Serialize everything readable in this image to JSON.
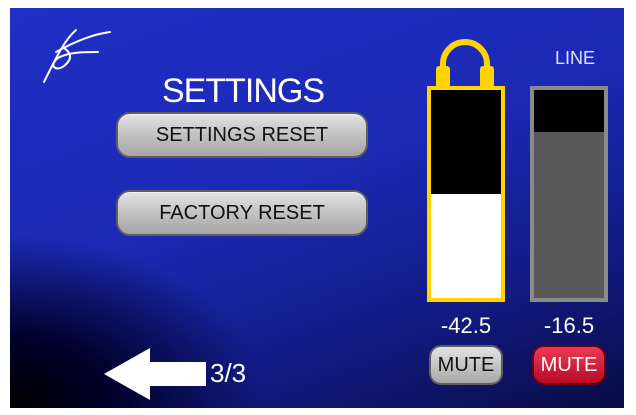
{
  "title": "SETTINGS",
  "buttons": {
    "settings_reset": "SETTINGS RESET",
    "factory_reset": "FACTORY RESET"
  },
  "channels": {
    "headphone": {
      "icon": "headphones-icon",
      "value": "-42.5",
      "level_fraction": 0.5,
      "mute_label": "MUTE",
      "muted": false,
      "color": "#ffd400"
    },
    "line": {
      "label": "LINE",
      "value": "-16.5",
      "level_fraction": 0.8,
      "mute_label": "MUTE",
      "muted": true,
      "color": "#8a8a8a"
    }
  },
  "navigation": {
    "page": "3/3",
    "back_icon": "arrow-left-icon"
  },
  "logo": "signature-logo"
}
